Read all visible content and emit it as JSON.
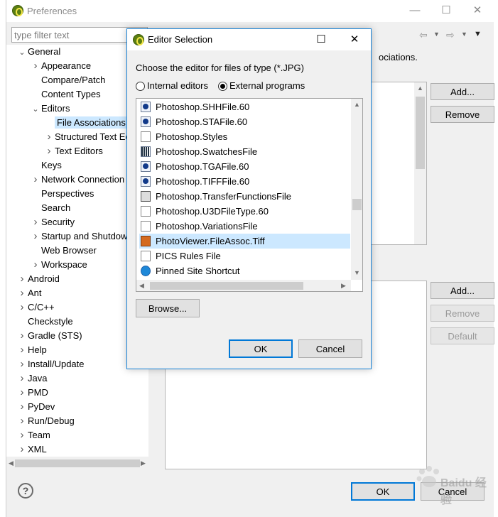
{
  "preferences": {
    "title": "Preferences",
    "filter_placeholder": "type filter text",
    "tree": [
      {
        "label": "General",
        "indent": 0,
        "twisty": "open"
      },
      {
        "label": "Appearance",
        "indent": 1,
        "twisty": "closed"
      },
      {
        "label": "Compare/Patch",
        "indent": 1,
        "twisty": "none"
      },
      {
        "label": "Content Types",
        "indent": 1,
        "twisty": "none"
      },
      {
        "label": "Editors",
        "indent": 1,
        "twisty": "open"
      },
      {
        "label": "File Associations",
        "indent": 2,
        "twisty": "none",
        "selected": true
      },
      {
        "label": "Structured Text Ed",
        "indent": 2,
        "twisty": "closed"
      },
      {
        "label": "Text Editors",
        "indent": 2,
        "twisty": "closed"
      },
      {
        "label": "Keys",
        "indent": 1,
        "twisty": "none"
      },
      {
        "label": "Network Connection",
        "indent": 1,
        "twisty": "closed"
      },
      {
        "label": "Perspectives",
        "indent": 1,
        "twisty": "none"
      },
      {
        "label": "Search",
        "indent": 1,
        "twisty": "none"
      },
      {
        "label": "Security",
        "indent": 1,
        "twisty": "closed"
      },
      {
        "label": "Startup and Shutdow",
        "indent": 1,
        "twisty": "closed"
      },
      {
        "label": "Web Browser",
        "indent": 1,
        "twisty": "none"
      },
      {
        "label": "Workspace",
        "indent": 1,
        "twisty": "closed"
      },
      {
        "label": "Android",
        "indent": 0,
        "twisty": "closed"
      },
      {
        "label": "Ant",
        "indent": 0,
        "twisty": "closed"
      },
      {
        "label": "C/C++",
        "indent": 0,
        "twisty": "closed"
      },
      {
        "label": "Checkstyle",
        "indent": 0,
        "twisty": "none"
      },
      {
        "label": "Gradle (STS)",
        "indent": 0,
        "twisty": "closed"
      },
      {
        "label": "Help",
        "indent": 0,
        "twisty": "closed"
      },
      {
        "label": "Install/Update",
        "indent": 0,
        "twisty": "closed"
      },
      {
        "label": "Java",
        "indent": 0,
        "twisty": "closed"
      },
      {
        "label": "PMD",
        "indent": 0,
        "twisty": "closed"
      },
      {
        "label": "PyDev",
        "indent": 0,
        "twisty": "closed"
      },
      {
        "label": "Run/Debug",
        "indent": 0,
        "twisty": "closed"
      },
      {
        "label": "Team",
        "indent": 0,
        "twisty": "closed"
      },
      {
        "label": "XML",
        "indent": 0,
        "twisty": "closed"
      }
    ],
    "content_text": "ociations.",
    "add_label": "Add...",
    "remove_label": "Remove",
    "add2_label": "Add...",
    "remove2_label": "Remove",
    "default_label": "Default",
    "ok_label": "OK",
    "cancel_label": "Cancel",
    "help_glyph": "?"
  },
  "dialog": {
    "title": "Editor Selection",
    "prompt": "Choose the editor for files of type (*.JPG)",
    "radio_internal": "Internal editors",
    "radio_external": "External programs",
    "selected_radio": "external",
    "programs": [
      {
        "label": "Photoshop.SHHFile.60",
        "icon": "ps"
      },
      {
        "label": "Photoshop.STAFile.60",
        "icon": "ps"
      },
      {
        "label": "Photoshop.Styles",
        "icon": "doc"
      },
      {
        "label": "Photoshop.SwatchesFile",
        "icon": "grid"
      },
      {
        "label": "Photoshop.TGAFile.60",
        "icon": "ps"
      },
      {
        "label": "Photoshop.TIFFFile.60",
        "icon": "ps"
      },
      {
        "label": "Photoshop.TransferFunctionsFile",
        "icon": "gear"
      },
      {
        "label": "Photoshop.U3DFileType.60",
        "icon": "doc"
      },
      {
        "label": "Photoshop.VariationsFile",
        "icon": "doc"
      },
      {
        "label": "PhotoViewer.FileAssoc.Tiff",
        "icon": "photo",
        "selected": true
      },
      {
        "label": "PICS Rules File",
        "icon": "doc"
      },
      {
        "label": "Pinned Site Shortcut",
        "icon": "ie"
      }
    ],
    "browse_label": "Browse...",
    "ok_label": "OK",
    "cancel_label": "Cancel",
    "accent_color": "#0078d7",
    "selection_color": "#cce8ff"
  },
  "watermark": {
    "text": "Baidu 经验"
  }
}
